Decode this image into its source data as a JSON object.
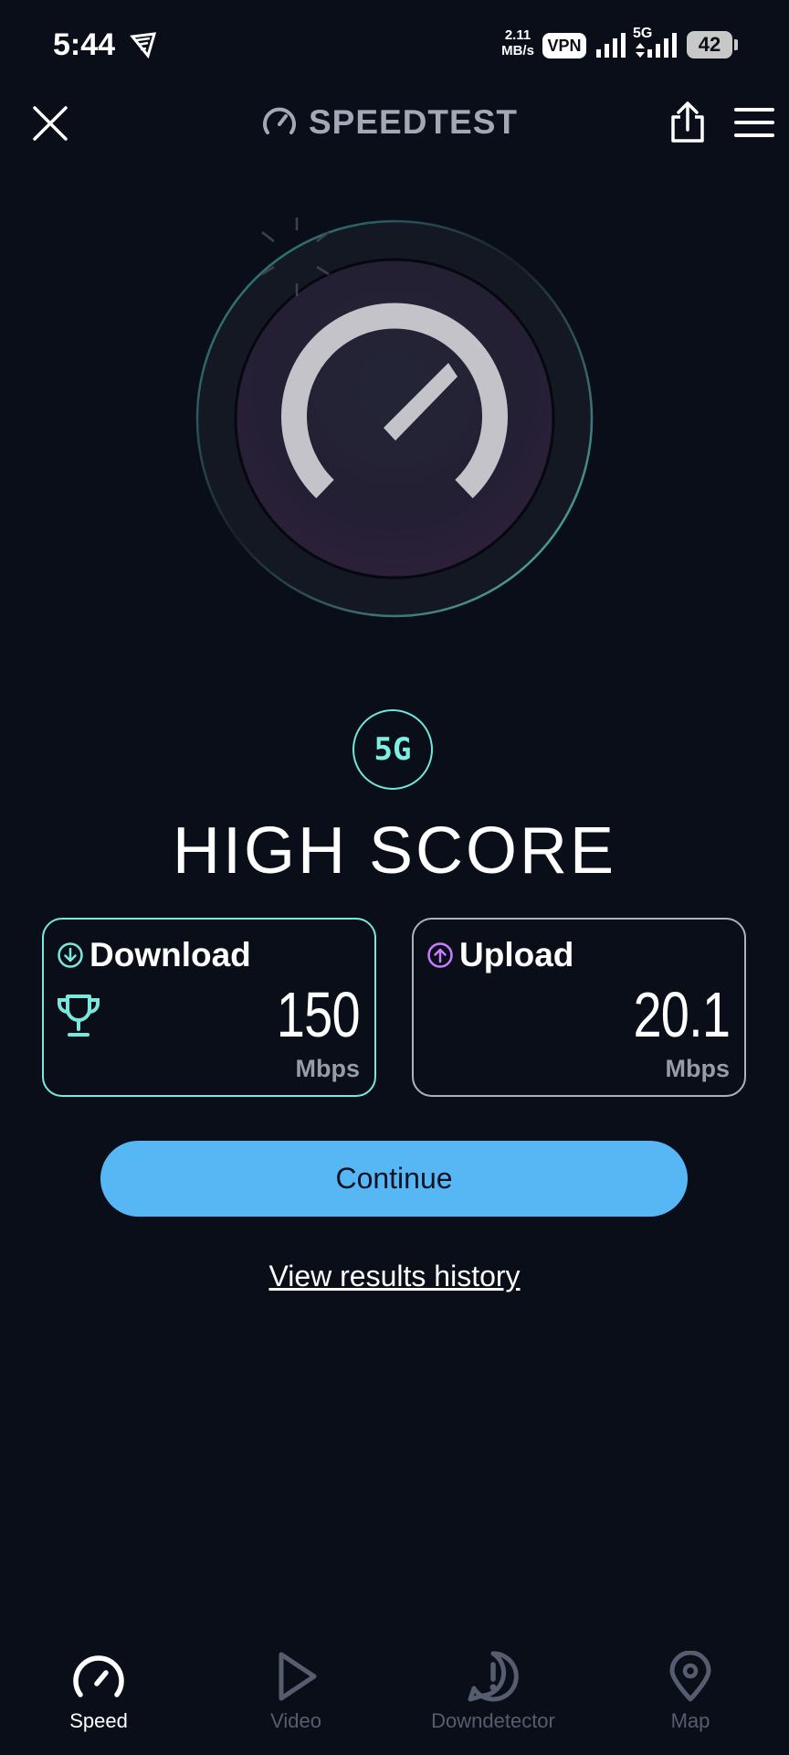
{
  "status_bar": {
    "time": "5:44",
    "net_speed_value": "2.11",
    "net_speed_unit": "MB/s",
    "vpn": "VPN",
    "network": "5G",
    "battery": "42"
  },
  "header": {
    "title": "SPEEDTEST",
    "close_icon": "close-icon",
    "share_icon": "share-icon",
    "menu_icon": "menu-icon"
  },
  "result": {
    "network_type": "5G",
    "headline": "HIGH SCORE",
    "download": {
      "label": "Download",
      "value": "150",
      "unit": "Mbps",
      "icon": "download-arrow-icon",
      "badge_icon": "trophy-icon"
    },
    "upload": {
      "label": "Upload",
      "value": "20.1",
      "unit": "Mbps",
      "icon": "upload-arrow-icon"
    }
  },
  "actions": {
    "continue_label": "Continue",
    "history_label": "View results history"
  },
  "bottom_nav": [
    {
      "label": "Speed",
      "icon": "speedometer-icon",
      "active": true
    },
    {
      "label": "Video",
      "icon": "play-icon",
      "active": false
    },
    {
      "label": "Downdetector",
      "icon": "alert-icon",
      "active": false
    },
    {
      "label": "Map",
      "icon": "map-pin-icon",
      "active": false
    }
  ],
  "colors": {
    "background": "#0a0e19",
    "accent_teal": "#7ae8dc",
    "accent_blue": "#57b7f5",
    "upload_purple": "#c77dff"
  }
}
